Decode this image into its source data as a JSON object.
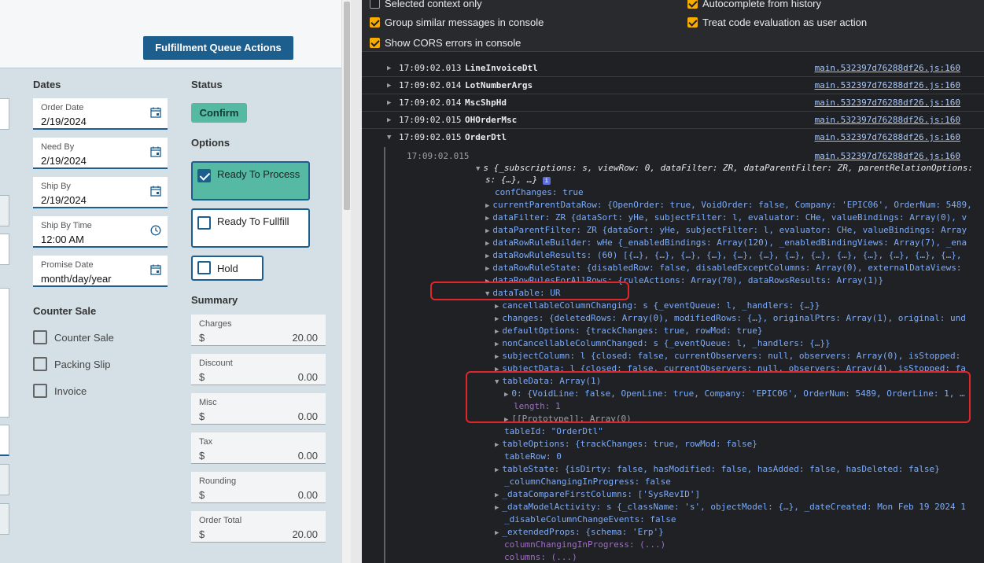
{
  "app": {
    "queue_button": "Fulfillment Queue Actions",
    "dates": {
      "title": "Dates",
      "fields": [
        {
          "label": "Order Date",
          "value": "2/19/2024",
          "icon": "calendar-icon"
        },
        {
          "label": "Need By",
          "value": "2/19/2024",
          "icon": "calendar-icon"
        },
        {
          "label": "Ship By",
          "value": "2/19/2024",
          "icon": "calendar-icon"
        },
        {
          "label": "Ship By Time",
          "value": "12:00 AM",
          "icon": "clock-icon"
        },
        {
          "label": "Promise Date",
          "value": "month/day/year",
          "icon": "calendar-icon"
        }
      ]
    },
    "status": {
      "title": "Status",
      "badge": "Confirm"
    },
    "options": {
      "title": "Options",
      "items": [
        {
          "label": "Ready To Process",
          "checked": true
        },
        {
          "label": "Ready To Fullfill",
          "checked": false
        },
        {
          "label": "Hold",
          "checked": false
        }
      ]
    },
    "counter_sale": {
      "title": "Counter Sale",
      "items": [
        "Counter Sale",
        "Packing Slip",
        "Invoice"
      ]
    },
    "summary": {
      "title": "Summary",
      "currency": "$",
      "items": [
        {
          "label": "Charges",
          "amount": "20.00"
        },
        {
          "label": "Discount",
          "amount": "0.00"
        },
        {
          "label": "Misc",
          "amount": "0.00"
        },
        {
          "label": "Tax",
          "amount": "0.00"
        },
        {
          "label": "Rounding",
          "amount": "0.00"
        },
        {
          "label": "Order Total",
          "amount": "20.00"
        }
      ]
    }
  },
  "devtools": {
    "settings": [
      {
        "label": "Selected context only",
        "checked": false
      },
      {
        "label": "Autocomplete from history",
        "checked": true
      },
      {
        "label": "Group similar messages in console",
        "checked": true
      },
      {
        "label": "Treat code evaluation as user action",
        "checked": true
      },
      {
        "label": "Show CORS errors in console",
        "checked": true
      }
    ],
    "logs": [
      {
        "time": "17:09:02.013",
        "name": "LineInvoiceDtl",
        "source": "main.532397d76288df26.js:160"
      },
      {
        "time": "17:09:02.014",
        "name": "LotNumberArgs",
        "source": "main.532397d76288df26.js:160"
      },
      {
        "time": "17:09:02.014",
        "name": "MscShpHd",
        "source": "main.532397d76288df26.js:160"
      },
      {
        "time": "17:09:02.015",
        "name": "OHOrderMsc",
        "source": "main.532397d76288df26.js:160"
      },
      {
        "time": "17:09:02.015",
        "name": "OrderDtl",
        "source": "main.532397d76288df26.js:160"
      }
    ],
    "group": {
      "time": "17:09:02.015",
      "source": "main.532397d76288df26.js:160",
      "lines": [
        "s {_subscriptions: s, viewRow: 0, dataFilter: ZR, dataParentFilter: ZR, parentRelationOptions:",
        "s: {…}, …}",
        "confChanges: true",
        "currentParentDataRow: {OpenOrder: true, VoidOrder: false, Company: 'EPIC06', OrderNum: 5489,",
        "dataFilter: ZR {dataSort: yHe, subjectFilter: l, evaluator: CHe, valueBindings: Array(0), v",
        "dataParentFilter: ZR {dataSort: yHe, subjectFilter: l, evaluator: CHe, valueBindings: Array",
        "dataRowRuleBuilder: wHe {_enabledBindings: Array(120), _enabledBindingViews: Array(7), _ena",
        "dataRowRuleResults: (60) [{…}, {…}, {…}, {…}, {…}, {…}, {…}, {…}, {…}, {…}, {…}, {…}, {…},",
        "dataRowRuleState: {disabledRow: false, disabledExceptColumns: Array(0), externalDataViews:",
        "dataRowRulesForAllRows: {ruleActions: Array(70), dataRowsResults: Array(1)}",
        "dataTable: UR",
        "cancellableColumnChanging: s {_eventQueue: l, _handlers: {…}}",
        "changes: {deletedRows: Array(0), modifiedRows: {…}, originalPtrs: Array(1), original: und",
        "defaultOptions: {trackChanges: true, rowMod: true}",
        "nonCancellableColumnChanged: s {_eventQueue: l, _handlers: {…}}",
        "subjectColumn: l {closed: false, currentObservers: null, observers: Array(0), isStopped:",
        "subjectData: l {closed: false, currentObservers: null, observers: Array(4), isStopped: fa",
        "tableData: Array(1)",
        "0: {VoidLine: false, OpenLine: true, Company: 'EPIC06', OrderNum: 5489, OrderLine: 1, …",
        "length: 1",
        "[[Prototype]]: Array(0)",
        "tableId: \"OrderDtl\"",
        "tableOptions: {trackChanges: true, rowMod: false}",
        "tableRow: 0",
        "tableState: {isDirty: false, hasModified: false, hasAdded: false, hasDeleted: false}",
        "_columnChangingInProgress: false",
        "_dataCompareFirstColumns: ['SysRevID']",
        "_dataModelActivity: s {_className: 's', objectModel: {…}, _dateCreated: Mon Feb 19 2024 1",
        "_disableColumnChangeEvents: false",
        "_extendedProps: {schema: 'Erp'}",
        "columnChangingInProgress: (...)",
        "columns: (...)"
      ]
    }
  },
  "colors": {
    "primary": "#1c5f8f",
    "teal": "#56b9a4",
    "console_bg": "#202124",
    "highlight": "#e0252b"
  }
}
